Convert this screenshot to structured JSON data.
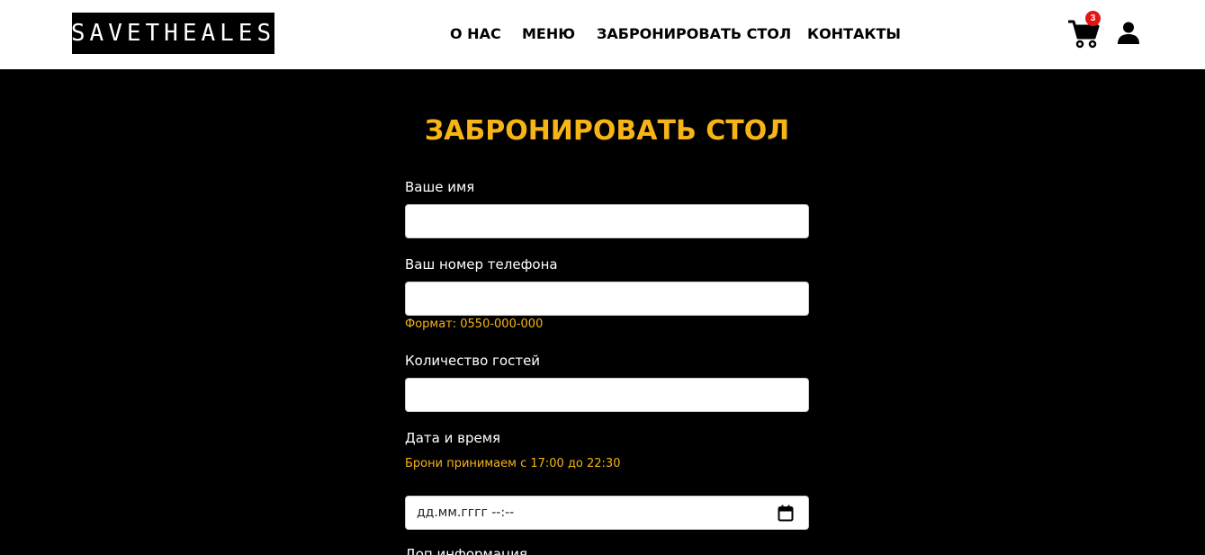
{
  "header": {
    "logo": "SAVETHEALES",
    "nav": [
      {
        "label": "О НАС"
      },
      {
        "label": "МЕНЮ"
      },
      {
        "label": "ЗАБРОНИРОВАТЬ СТОЛ"
      },
      {
        "label": "КОНТАКТЫ"
      }
    ],
    "cart_count": "3",
    "cart_icon": "shopping-cart-icon",
    "user_icon": "user-icon"
  },
  "form": {
    "title": "ЗАБРОНИРОВАТЬ СТОЛ",
    "name_label": "Ваше имя",
    "name_value": "",
    "phone_label": "Ваш номер телефона",
    "phone_value": "",
    "phone_hint": "Формат: 0550-000-000",
    "guests_label": "Количество гостей",
    "guests_value": "",
    "datetime_label": "Дата и время",
    "datetime_hint": "Брони принимаем с 17:00 до 22:30",
    "datetime_placeholder": "дд.мм.гггг --:--",
    "extra_label": "Доп.информация"
  },
  "colors": {
    "accent": "#f6b416",
    "badge": "#e41414",
    "background": "#000000",
    "header_bg": "#ffffff"
  }
}
